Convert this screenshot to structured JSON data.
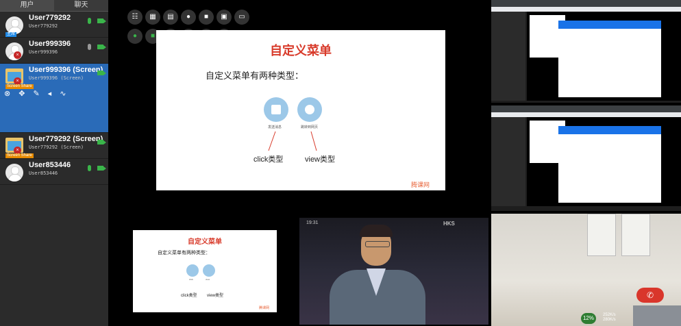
{
  "tabs": [
    {
      "label": "用户"
    },
    {
      "label": "聊天"
    }
  ],
  "users": [
    {
      "name": "User779292",
      "sub": "User779292",
      "badge": "主席"
    },
    {
      "name": "User999396",
      "sub": "User999396",
      "badge": ""
    },
    {
      "name": "User999396 (Screen)",
      "sub": "User999396 (Screen)",
      "badge": "Screen Share"
    },
    {
      "name": "User779292 (Screen)",
      "sub": "User779292 (Screen)",
      "badge": "Screen Share"
    },
    {
      "name": "User853446",
      "sub": "User853446",
      "badge": ""
    }
  ],
  "slide": {
    "title": "自定义菜单",
    "text": "自定义菜单有两种类型：",
    "icon1_caption": "发送消息",
    "icon2_caption": "跳转到网页",
    "label1": "click类型",
    "label2": "view类型",
    "logo": "腾课网"
  },
  "slide_small": {
    "title": "自定义菜单",
    "text": "自定义菜单有两种类型：",
    "icon1_caption": "click",
    "icon2_caption": "view",
    "label1": "click类型",
    "label2": "view类型",
    "logo": "腾课网"
  },
  "video": {
    "overlay": "19:31",
    "logo": "HKS"
  },
  "status": {
    "percent": "12%",
    "up": "252K/s",
    "down": "280K/s"
  },
  "icons": {
    "toolbar": [
      "users-icon",
      "film-icon",
      "video-file-icon",
      "record-icon",
      "whiteboard-icon",
      "image-icon",
      "layout-icon",
      "mic-icon",
      "camera-icon",
      "fullscreen-icon",
      "screen-share-icon",
      "headset-icon",
      "grid-icon"
    ]
  }
}
